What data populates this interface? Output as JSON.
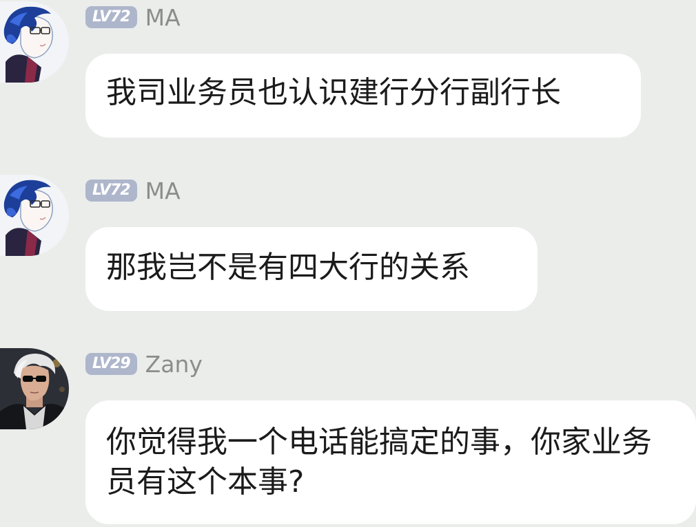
{
  "messages": [
    {
      "level": "LV72",
      "username": "MA",
      "text": "我司业务员也认识建行分行副行长"
    },
    {
      "level": "LV72",
      "username": "MA",
      "text": "那我岂不是有四大行的关系"
    },
    {
      "level": "LV29",
      "username": "Zany",
      "text": "你觉得我一个电话能搞定的事，你家业务员有这个本事?"
    }
  ],
  "colors": {
    "background": "#eaedea",
    "bubble": "#ffffff",
    "level_badge": "#aeb6cc",
    "username": "#8c8c8c",
    "text": "#1b1b1b"
  },
  "icons": [
    "avatar-anime-boy",
    "avatar-anime-boy",
    "avatar-sunglasses-man"
  ]
}
